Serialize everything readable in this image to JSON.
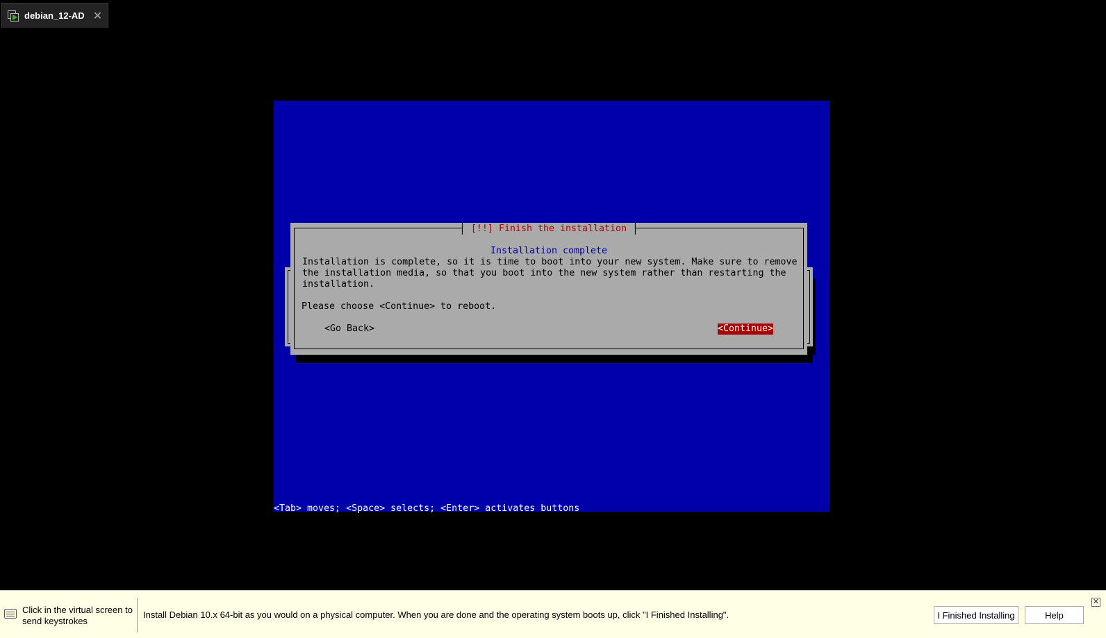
{
  "tab": {
    "title": "debian_12-AD",
    "close_glyph": "✕"
  },
  "installer": {
    "dialog_title": "[!!] Finish the installation",
    "subtitle": "Installation complete",
    "body": "Installation is complete, so it is time to boot into your new system. Make sure to remove\nthe installation media, so that you boot into the new system rather than restarting the\ninstallation.",
    "prompt": "Please choose <Continue> to reboot.",
    "go_back": "<Go Back>",
    "continue": "<Continue>",
    "help_line": "<Tab> moves; <Space> selects; <Enter> activates buttons",
    "colors": {
      "screen": "#0000aa",
      "dialog": "#aaaaaa",
      "title": "#aa0000",
      "selected": "#aa0000"
    }
  },
  "hintbar": {
    "click_hint": "Click in the virtual screen to send keystrokes",
    "instruction": "Install Debian 10.x 64-bit as you would on a physical computer. When you are done and the operating system boots up, click \"I Finished Installing\".",
    "finished_button": "I Finished Installing",
    "help_button": "Help",
    "close_glyph": "✕"
  }
}
